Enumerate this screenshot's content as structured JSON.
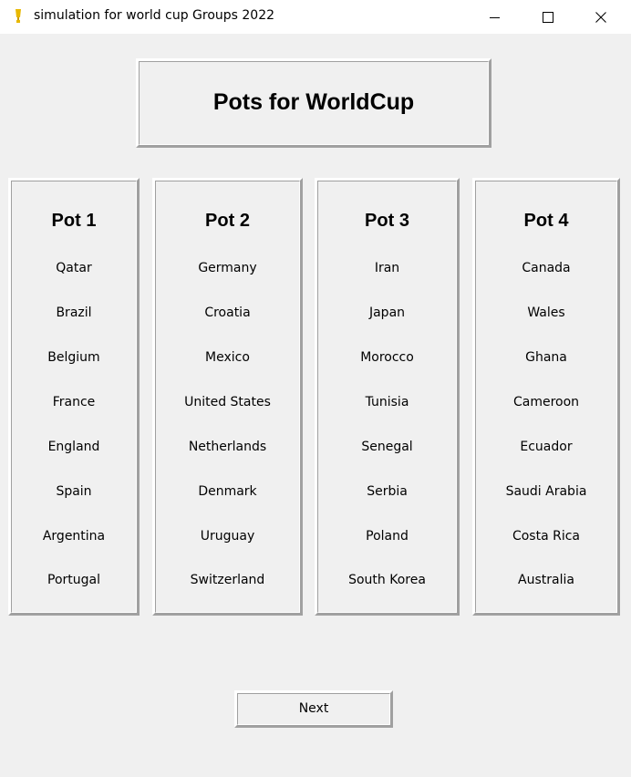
{
  "window": {
    "title": "simulation for world cup Groups 2022",
    "icon": "trophy-icon",
    "controls": [
      "minimize-icon",
      "maximize-icon",
      "close-icon"
    ]
  },
  "header": {
    "title": "Pots for WorldCup"
  },
  "pots": [
    {
      "title": "Pot 1",
      "teams": [
        "Qatar",
        "Brazil",
        "Belgium",
        "France",
        "England",
        "Spain",
        "Argentina",
        "Portugal"
      ]
    },
    {
      "title": "Pot 2",
      "teams": [
        "Germany",
        "Croatia",
        "Mexico",
        "United States",
        "Netherlands",
        "Denmark",
        "Uruguay",
        "Switzerland"
      ]
    },
    {
      "title": "Pot 3",
      "teams": [
        "Iran",
        "Japan",
        "Morocco",
        "Tunisia",
        "Senegal",
        "Serbia",
        "Poland",
        "South Korea"
      ]
    },
    {
      "title": "Pot 4",
      "teams": [
        "Canada",
        "Wales",
        "Ghana",
        "Cameroon",
        "Ecuador",
        "Saudi Arabia",
        "Costa Rica",
        "Australia"
      ]
    }
  ],
  "footer": {
    "next_label": "Next"
  },
  "colors": {
    "background": "#f0f0f0",
    "titlebar": "#ffffff",
    "icon_accent": "#e8b800"
  }
}
